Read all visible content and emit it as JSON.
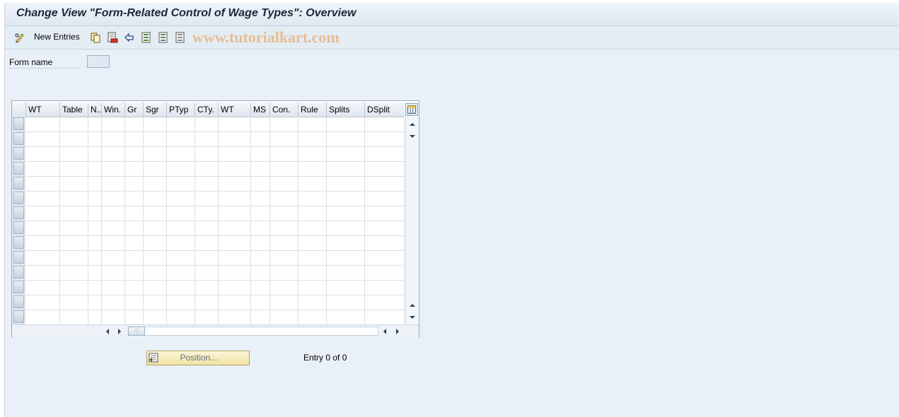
{
  "window": {
    "title": "Change View \"Form-Related Control of Wage Types\": Overview"
  },
  "toolbar": {
    "new_entries_label": "New Entries",
    "watermark": "www.tutorialkart.com",
    "icons": [
      "change-display-icon",
      "copy-icon",
      "delete-icon",
      "undo-icon",
      "select-all-icon",
      "select-block-icon",
      "deselect-all-icon"
    ]
  },
  "form": {
    "form_name_label": "Form name",
    "form_name_value": ""
  },
  "table": {
    "columns": [
      "WT",
      "Table",
      "N..",
      "Win.",
      "Gr",
      "Sgr",
      "PTyp",
      "CTy.",
      "WT",
      "MS",
      "Con.",
      "Rule",
      "Splits",
      "DSplit"
    ],
    "rows": [],
    "empty_row_count": 14
  },
  "footer": {
    "position_button_label": "Position...",
    "entry_text": "Entry 0 of 0"
  },
  "colors": {
    "background": "#e9f0f7",
    "position_button": "#f5eab8",
    "watermark": "#e8b98a"
  }
}
